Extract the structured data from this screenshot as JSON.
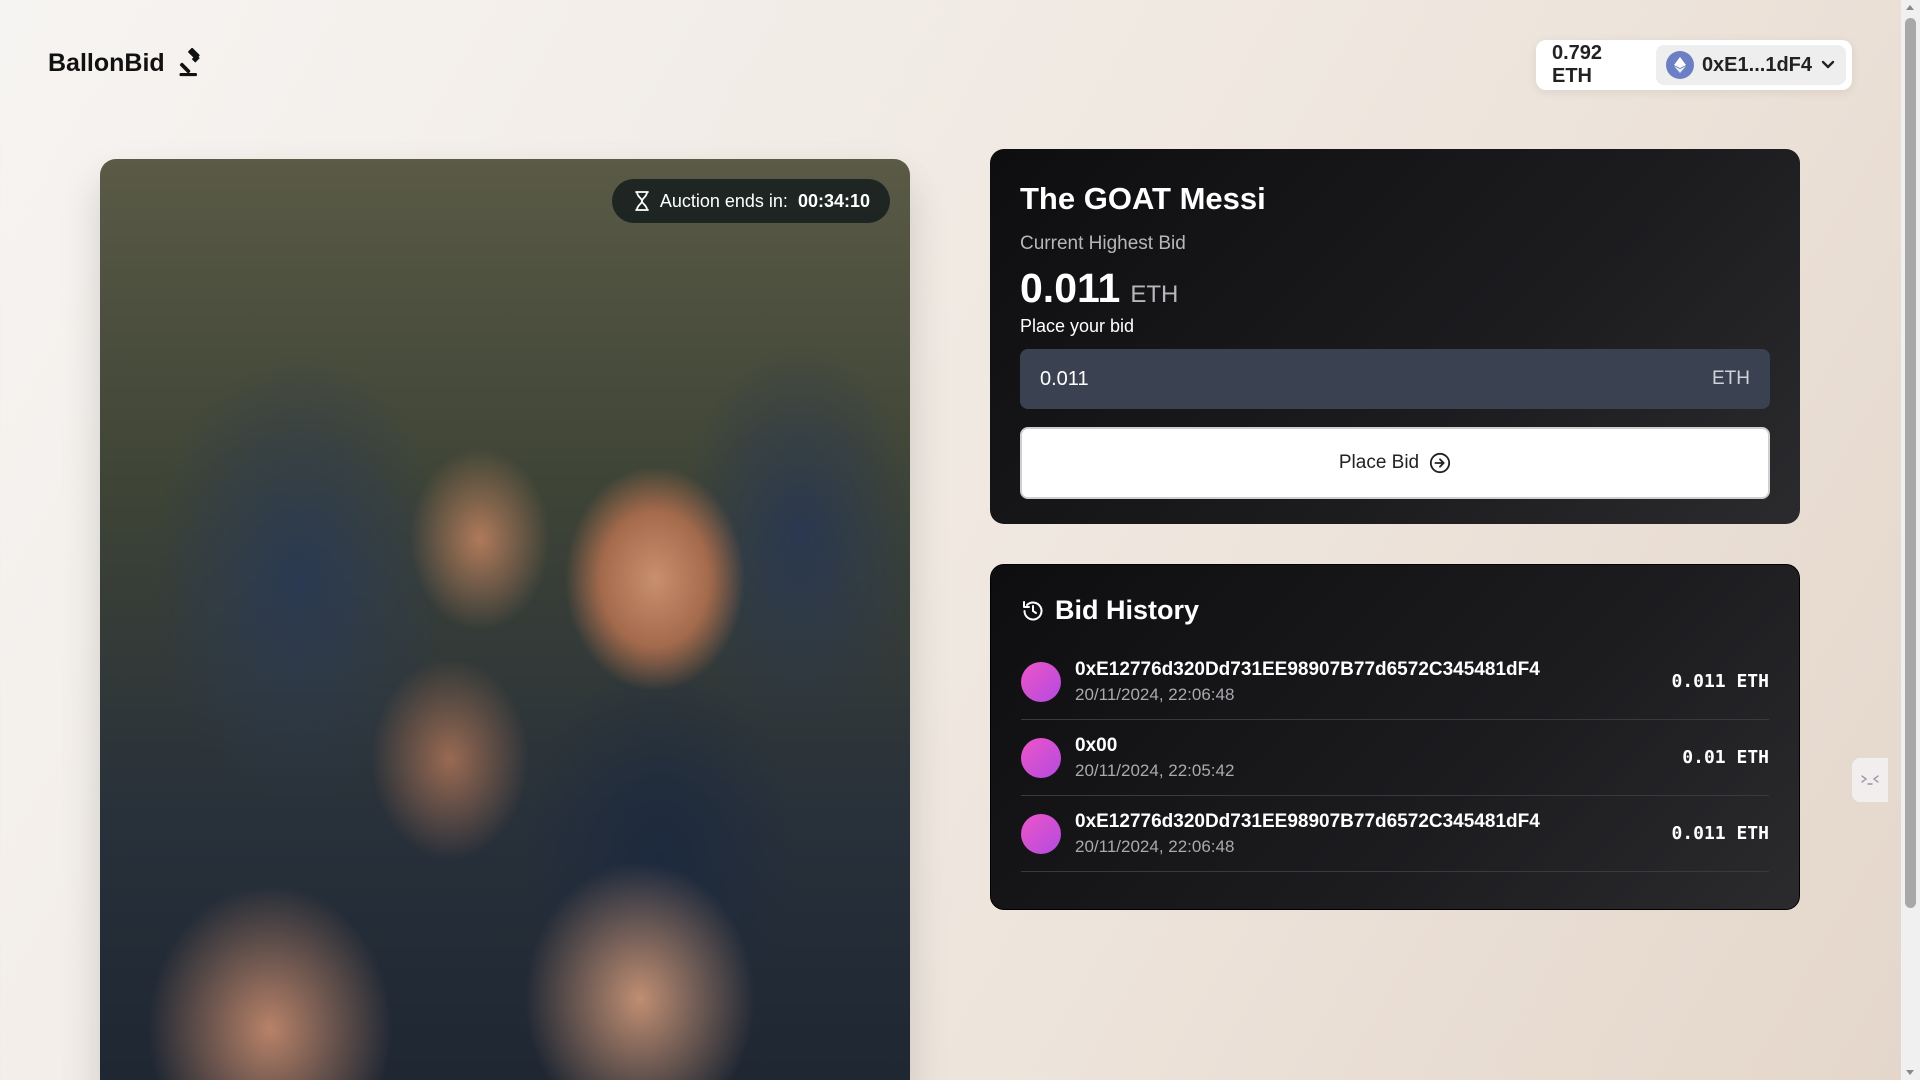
{
  "header": {
    "brand": "BallonBid",
    "brand_icon": "gavel-icon",
    "wallet_balance": "0.792 ETH",
    "wallet_address": "0xE1...1dF4"
  },
  "auction": {
    "timer_label": "Auction ends in:",
    "timer_value": "00:34:10",
    "title": "The GOAT Messi",
    "current_bid_label": "Current Highest Bid",
    "current_bid_value": "0.011",
    "current_bid_unit": "ETH",
    "place_label": "Place your bid",
    "input_value": "0.011",
    "input_unit": "ETH",
    "place_button": "Place Bid"
  },
  "history": {
    "title": "Bid History",
    "rows": [
      {
        "address": "0xE12776d320Dd731EE98907B77d6572C345481dF4",
        "time": "20/11/2024, 22:06:48",
        "amount": "0.011 ETH"
      },
      {
        "address": "0x00",
        "time": "20/11/2024, 22:05:42",
        "amount": "0.01 ETH"
      },
      {
        "address": "0xE12776d320Dd731EE98907B77d6572C345481dF4",
        "time": "20/11/2024, 22:06:48",
        "amount": "0.011 ETH"
      }
    ]
  },
  "colors": {
    "card_bg": "#151517",
    "input_bg": "#3a4252",
    "avatar_gradient_start": "#ee55c8",
    "avatar_gradient_end": "#b34ae0",
    "wallet_avatar": "#6d7fc4"
  }
}
